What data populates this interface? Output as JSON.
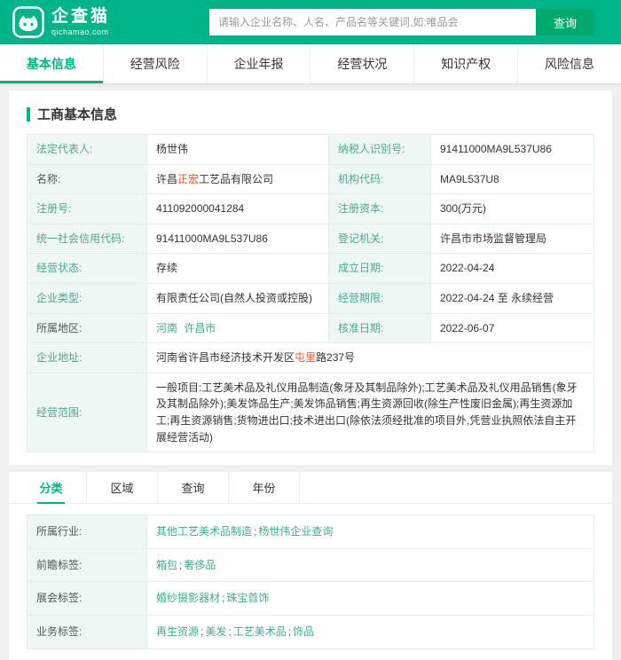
{
  "header": {
    "logo_title": "企查猫",
    "logo_subtitle": "qichamao.com",
    "search_placeholder": "请输入企业名称、人名、产品名等关键词,如:唯品会",
    "search_button": "查询"
  },
  "nav": {
    "tabs": [
      {
        "label": "基本信息"
      },
      {
        "label": "经营风险"
      },
      {
        "label": "企业年报"
      },
      {
        "label": "经营状况"
      },
      {
        "label": "知识产权"
      },
      {
        "label": "风险信息"
      }
    ]
  },
  "section_title": "工商基本信息",
  "info": {
    "rows": [
      {
        "l1": "法定代表人:",
        "v1": "杨世伟",
        "l2": "纳税人识别号:",
        "v2": "91411000MA9L537U86"
      },
      {
        "l1": "名称:",
        "v1_parts": [
          {
            "t": "许昌"
          },
          {
            "t": "正宏",
            "hl": true
          },
          {
            "t": "工艺品有限公司"
          }
        ],
        "l2": "机构代码:",
        "v2": "MA9L537U8"
      },
      {
        "l1": "注册号:",
        "v1": "411092000041284",
        "l2": "注册资本:",
        "v2": "300(万元)"
      },
      {
        "l1": "统一社会信用代码:",
        "v1": "91411000MA9L537U86",
        "l2": "登记机关:",
        "v2": "许昌市市场监督管理局"
      },
      {
        "l1": "经营状态:",
        "v1": "存续",
        "l2": "成立日期:",
        "v2": "2022-04-24"
      },
      {
        "l1": "企业类型:",
        "v1": "有限责任公司(自然人投资或控股)",
        "l2": "经营期限:",
        "v2": "2022-04-24 至 永续经营"
      },
      {
        "l1": "所属地区:",
        "v1_links": {
          "items": [
            "河南",
            "许昌市"
          ],
          "sep": " "
        },
        "l2": "核准日期:",
        "v2": "2022-06-07"
      },
      {
        "l1": "企业地址:",
        "v1_parts": [
          {
            "t": "河南省许昌市经济技术开发区"
          },
          {
            "t": "屯里",
            "hl": true
          },
          {
            "t": "路237号"
          }
        ]
      },
      {
        "l1": "经营范围:",
        "v1": "一般项目:工艺美术品及礼仪用品制造(象牙及其制品除外);工艺美术品及礼仪用品销售(象牙及其制品除外);美发饰品生产;美发饰品销售;再生资源回收(除生产性废旧金属);再生资源加工;再生资源销售;货物进出口;技术进出口(除依法须经批准的项目外,凭营业执照依法自主开展经营活动)"
      }
    ]
  },
  "subtabs": [
    {
      "label": "分类"
    },
    {
      "label": "区域"
    },
    {
      "label": "查询"
    },
    {
      "label": "年份"
    }
  ],
  "tags": {
    "rows": [
      {
        "label": "所属行业:",
        "links": {
          "items": [
            "其他工艺美术品制造",
            "杨世伟企业查询"
          ],
          "sep": ";"
        }
      },
      {
        "label": "前瞻标签:",
        "links": {
          "items": [
            "箱包",
            "奢侈品"
          ],
          "sep": ";"
        }
      },
      {
        "label": "展会标签:",
        "links": {
          "items": [
            "婚纱摄影器材",
            "珠宝首饰"
          ],
          "sep": ";"
        }
      },
      {
        "label": "业务标签:",
        "links": {
          "items": [
            "再生资源",
            "美发",
            "工艺美术品",
            "饰品"
          ],
          "sep": ";"
        }
      }
    ]
  },
  "colors": {
    "brand_green": "#00b489",
    "link_green": "#43a794",
    "label_bg": "#eef7f4",
    "highlight_red": "#ff4e2b"
  }
}
